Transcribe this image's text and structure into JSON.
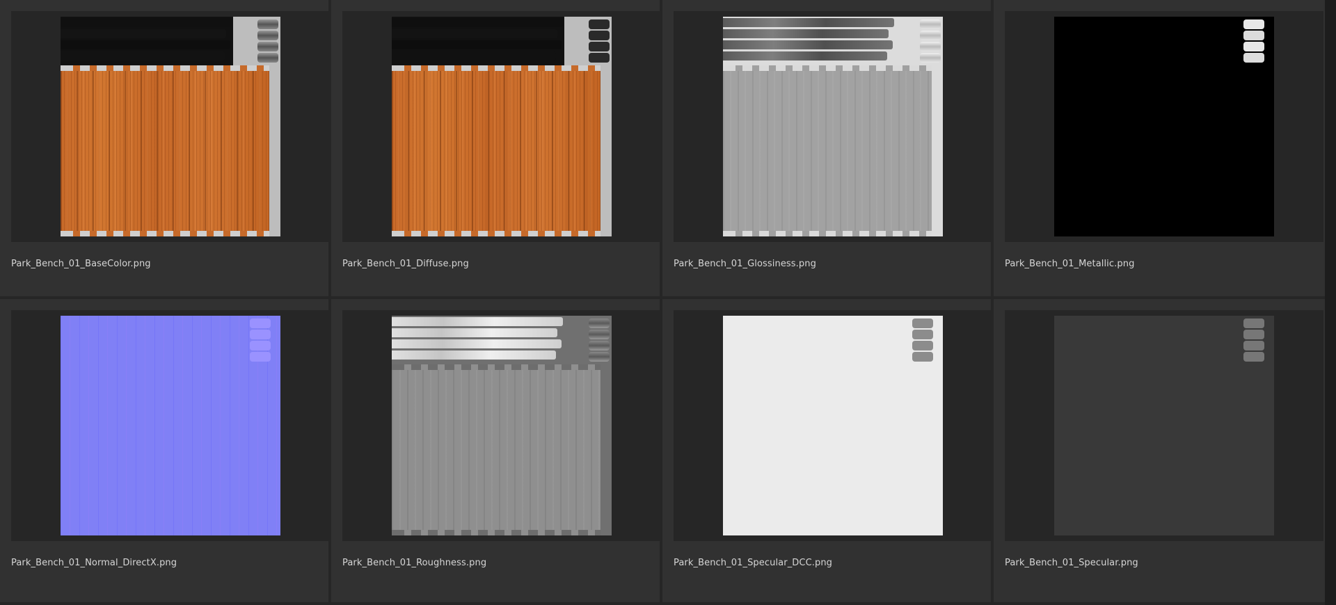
{
  "browser": {
    "items": [
      {
        "filename": "Park_Bench_01_BaseColor.png",
        "map": "BaseColor"
      },
      {
        "filename": "Park_Bench_01_Diffuse.png",
        "map": "Diffuse"
      },
      {
        "filename": "Park_Bench_01_Glossiness.png",
        "map": "Glossiness"
      },
      {
        "filename": "Park_Bench_01_Metallic.png",
        "map": "Metallic"
      },
      {
        "filename": "Park_Bench_01_Normal_DirectX.png",
        "map": "Normal_DirectX"
      },
      {
        "filename": "Park_Bench_01_Roughness.png",
        "map": "Roughness"
      },
      {
        "filename": "Park_Bench_01_Specular_DCC.png",
        "map": "Specular_DCC"
      },
      {
        "filename": "Park_Bench_01_Specular.png",
        "map": "Specular"
      }
    ]
  },
  "colors": {
    "background": "#2b2b2b",
    "tile": "#313131",
    "thumb_frame": "#262626",
    "label_text": "#d6d6d6",
    "wood": "#c86a2a",
    "normal": "#8080f6"
  }
}
